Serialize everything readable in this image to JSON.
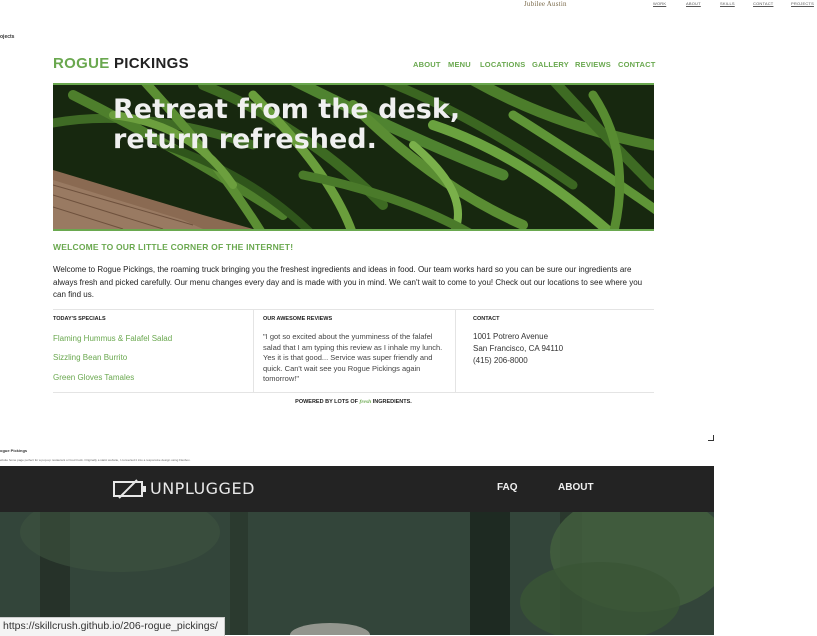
{
  "portfolio": {
    "owner_name": "Jubilee Austin",
    "nav": [
      "WORK",
      "ABOUT",
      "SKILLS",
      "CONTACT",
      "PROJECTS"
    ],
    "section_label": "ojects"
  },
  "site": {
    "logo_accent": "ROGUE",
    "logo_rest": "PICKINGS",
    "nav": [
      "ABOUT",
      "MENU",
      "LOCATIONS",
      "GALLERY",
      "REVIEWS",
      "CONTACT"
    ],
    "welcome_heading": "WELCOME TO OUR LITTLE CORNER OF THE INTERNET!",
    "intro": "Welcome to Rogue Pickings, the roaming truck bringing you the freshest ingredients and ideas in food. Our team works hard so you can be sure our ingredients are always fresh and picked carefully. Our menu changes every day and is made with you in mind. We can't wait to come to you! Check out our locations to see where you can find us.",
    "specials_heading": "TODAY'S SPECIALS",
    "specials": [
      "Flaming Hummus & Falafel Salad",
      "Sizzling Bean Burrito",
      "Green Gloves Tamales"
    ],
    "reviews_heading": "OUR AWESOME REVIEWS",
    "review": "\"I got so excited about the yumminess of the falafel salad that I am typing this review as I inhale my lunch. Yes it is that good... Service was super friendly and quick. Can't wait see you Rogue Pickings again tomorrow!\"",
    "contact_heading": "CONTACT",
    "contact_lines": [
      "1001 Potrero Avenue",
      "San Francisco, CA 94110",
      "(415) 206-8000"
    ],
    "powered_pre": "POWERED BY LOTS OF",
    "powered_fresh": "fresh",
    "powered_post": "INGREDIENTS.",
    "brand_color": "#6aa84f"
  },
  "caption": {
    "title": "ogue Pickings",
    "description": "ebsite home page perfect for a pop-up restaurant or food truck. Originally a static website, I converted it into a responsive design using Flexbox."
  },
  "unplugged": {
    "logo": "UNPLUGGED",
    "nav": [
      "FAQ",
      "ABOUT"
    ],
    "headline_1": "Retreat from the desk,",
    "headline_2": "return refreshed."
  },
  "status_url": "https://skillcrush.github.io/206-rogue_pickings/"
}
